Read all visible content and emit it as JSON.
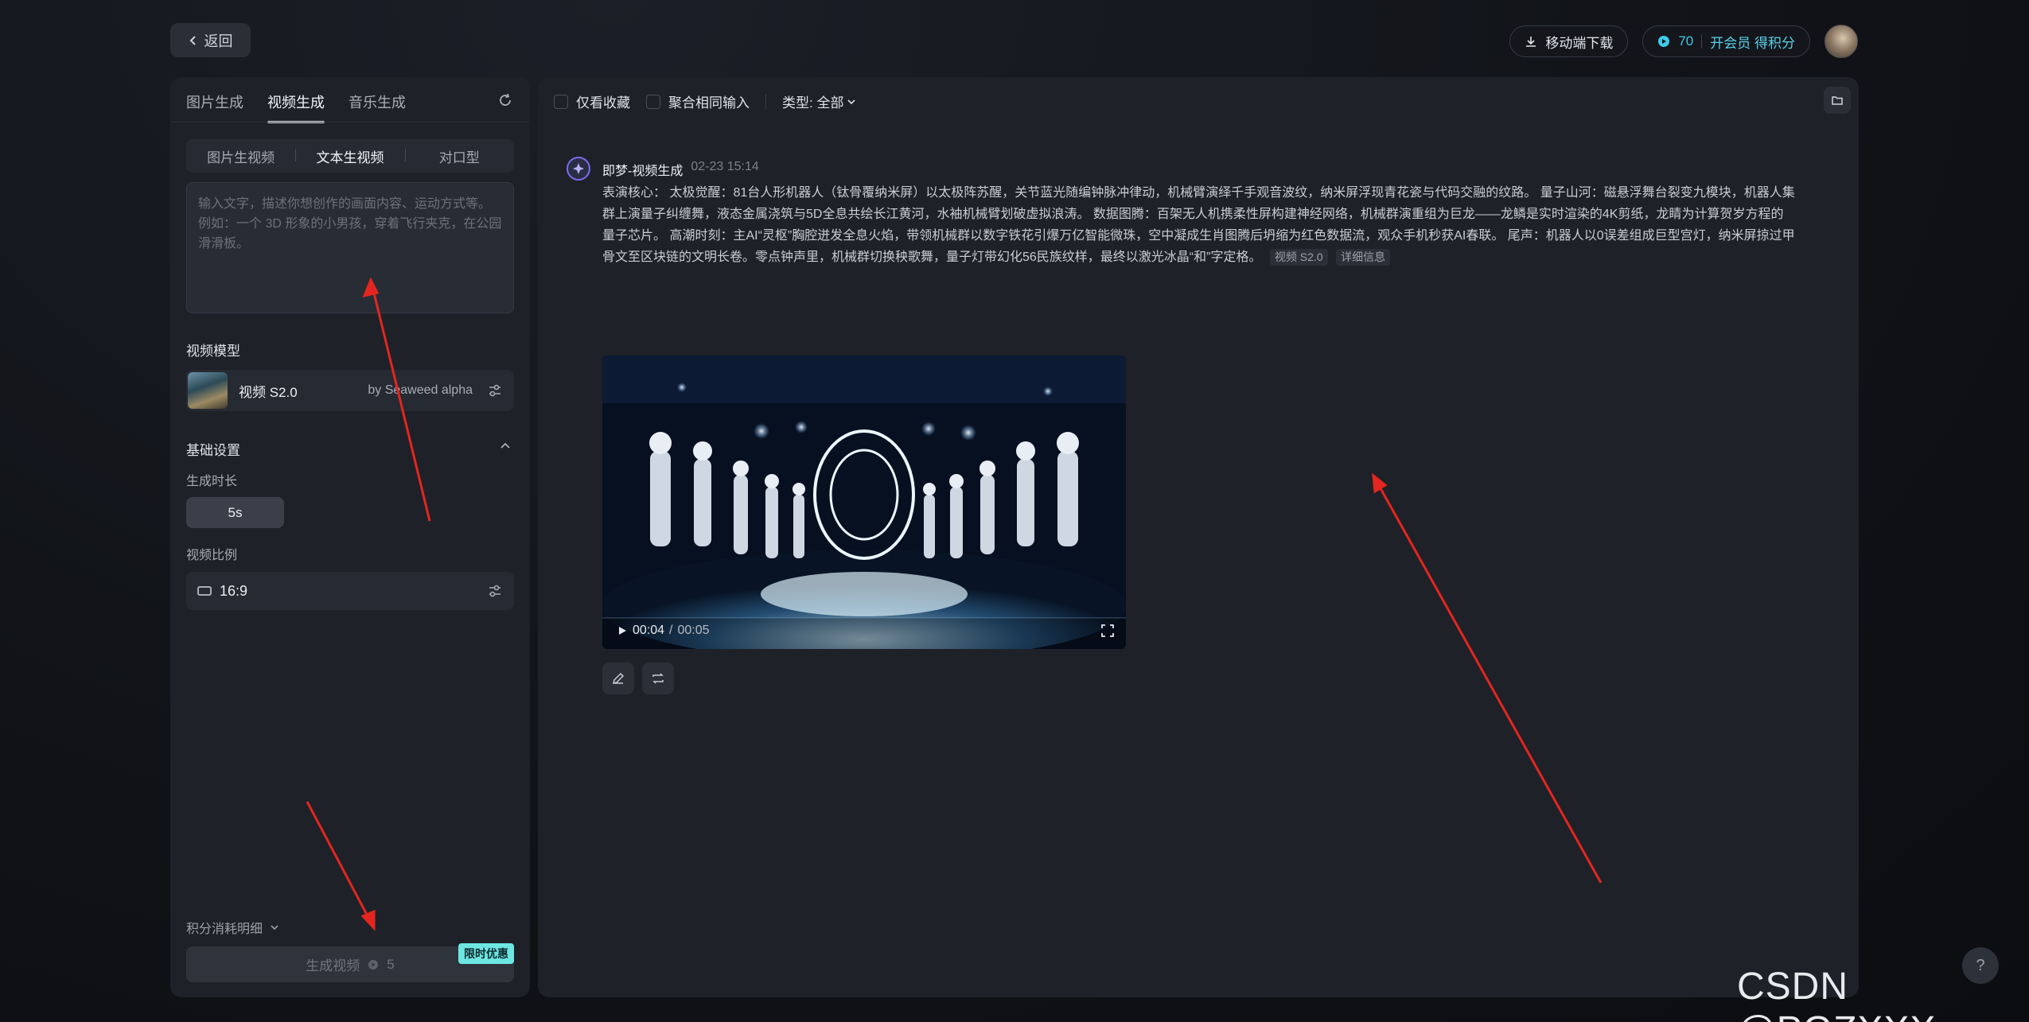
{
  "topbar": {
    "back_label": "返回",
    "download_label": "移动端下载",
    "credits": "70",
    "vip_label": "开会员 得积分"
  },
  "left": {
    "tabs": [
      "图片生成",
      "视频生成",
      "音乐生成"
    ],
    "active_tab": "视频生成",
    "mode_tabs": [
      "图片生视频",
      "文本生视频",
      "对口型"
    ],
    "active_mode": "文本生视频",
    "prompt_placeholder": "输入文字，描述你想创作的画面内容、运动方式等。例如：一个 3D 形象的小男孩，穿着飞行夹克，在公园滑滑板。",
    "model_section": "视频模型",
    "model_name": "视频 S2.0",
    "model_by": "by Seaweed alpha",
    "basic_section": "基础设置",
    "duration_label": "生成时长",
    "duration_value": "5s",
    "ratio_label": "视频比例",
    "ratio_value": "16:9",
    "cost_label": "积分消耗明细",
    "generate_label": "生成视频",
    "generate_cost": "5",
    "promo": "限时优惠"
  },
  "right": {
    "filter_fav": "仅看收藏",
    "filter_merge": "聚合相同输入",
    "filter_type": "类型: 全部",
    "record": {
      "title": "即梦-视频生成",
      "time": "02-23  15:14",
      "text": "表演核心：  太极觉醒：81台人形机器人（钛骨覆纳米屏）以太极阵苏醒，关节蓝光随编钟脉冲律动，机械臂演绎千手观音波纹，纳米屏浮现青花瓷与代码交融的纹路。 量子山河：磁悬浮舞台裂变九模块，机器人集群上演量子纠缠舞，液态金属浇筑与5D全息共绘长江黄河，水袖机械臂划破虚拟浪涛。 数据图腾：百架无人机携柔性屏构建神经网络，机械群演重组为巨龙——龙鳞是实时渲染的4K剪纸，龙睛为计算贺岁方程的量子芯片。 高潮时刻：主AI“灵枢”胸腔迸发全息火焰，带领机械群以数字铁花引爆万亿智能微珠，空中凝成生肖图腾后坍缩为红色数据流，观众手机秒获AI春联。 尾声：机器人以0误差组成巨型宫灯，纳米屏掠过甲骨文至区块链的文明长卷。零点钟声里，机械群切换秧歌舞，量子灯带幻化56民族纹样，最终以激光冰晶“和”字定格。",
      "tag_model": "视频 S2.0",
      "tag_detail": "详细信息",
      "video_current": "00:04",
      "video_total": "00:05"
    }
  },
  "watermark": "CSDN @PGZXXX",
  "help": "?",
  "colors": {
    "accent": "#3ecbe8",
    "annotation_arrow": "#e3261f",
    "promo": "#6ee7e3"
  }
}
